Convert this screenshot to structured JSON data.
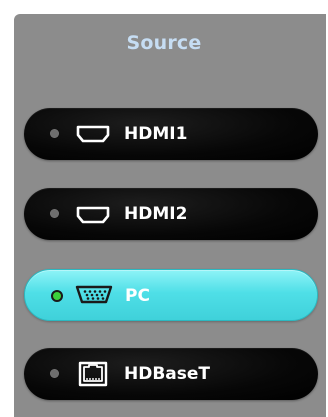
{
  "panel": {
    "title": "Source"
  },
  "sources": [
    {
      "label": "HDMI1",
      "icon": "hdmi-port-icon",
      "selected": false
    },
    {
      "label": "HDMI2",
      "icon": "hdmi-port-icon",
      "selected": false
    },
    {
      "label": "PC",
      "icon": "vga-port-icon",
      "selected": true
    },
    {
      "label": "HDBaseT",
      "icon": "ethernet-port-icon",
      "selected": false
    }
  ],
  "colors": {
    "panel_bg": "#8c8c8c",
    "title": "#c6ddf3",
    "button_bg": "#000000",
    "selected_bg": "#4fdfe7",
    "indicator_off": "#6e6e6e",
    "indicator_on": "#3bd13b"
  }
}
